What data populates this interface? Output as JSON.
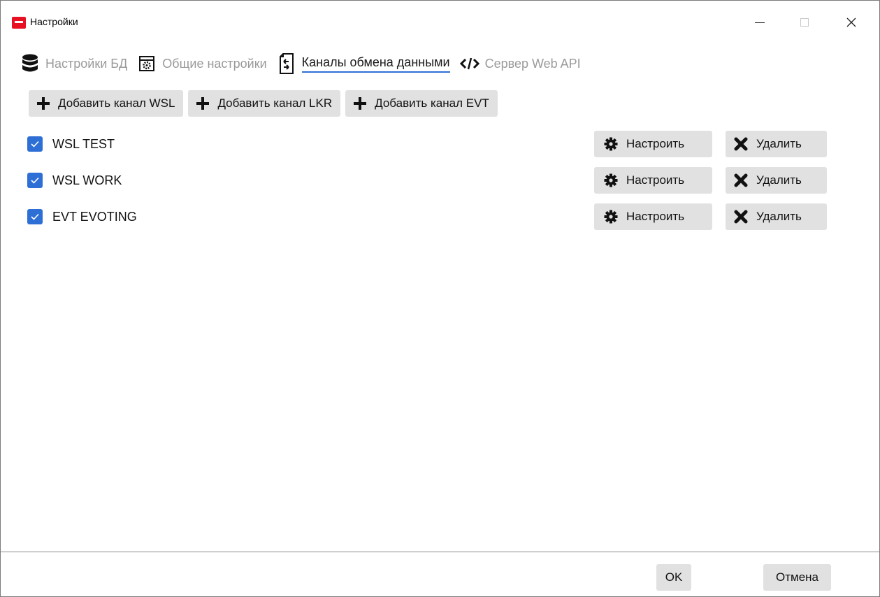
{
  "window": {
    "title": "Настройки"
  },
  "tabs": [
    {
      "label": "Настройки БД",
      "icon": "database-icon",
      "active": false
    },
    {
      "label": "Общие настройки",
      "icon": "settings-window-icon",
      "active": false
    },
    {
      "label": "Каналы обмена данными",
      "icon": "exchange-file-icon",
      "active": true
    },
    {
      "label": "Сервер Web API",
      "icon": "code-icon",
      "active": false
    }
  ],
  "add_buttons": [
    {
      "label": "Добавить канал WSL",
      "icon": "plus-icon"
    },
    {
      "label": "Добавить канал LKR",
      "icon": "plus-icon"
    },
    {
      "label": "Добавить канал EVT",
      "icon": "plus-icon"
    }
  ],
  "channels": [
    {
      "name": "WSL TEST",
      "checked": true
    },
    {
      "name": "WSL WORK",
      "checked": true
    },
    {
      "name": "EVT EVOTING",
      "checked": true
    }
  ],
  "row_actions": {
    "configure_label": "Настроить",
    "configure_icon": "gear-icon",
    "delete_label": "Удалить",
    "delete_icon": "x-icon"
  },
  "footer": {
    "ok_label": "OK",
    "cancel_label": "Отмена"
  },
  "colors": {
    "accent": "#2e6fd6",
    "button_bg": "#e1e1e1",
    "app_icon": "#e81123",
    "inactive_tab": "#9a9a9a"
  }
}
